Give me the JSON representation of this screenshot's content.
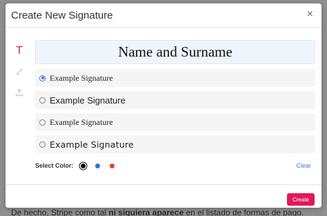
{
  "backdrop": {
    "text_before": "De hecho, Stripe como tal",
    "text_bold": "ni siquiera aparece",
    "text_after": "en el listado de formas de pago."
  },
  "modal": {
    "title": "Create New Signature",
    "close_symbol": "×"
  },
  "tools": [
    {
      "name": "text-tool",
      "glyph": "T",
      "active": true
    },
    {
      "name": "draw-tool",
      "icon": "brush-icon",
      "active": false
    },
    {
      "name": "upload-tool",
      "icon": "upload-icon",
      "active": false
    }
  ],
  "preview": {
    "text": "Name and Surname"
  },
  "options": [
    {
      "label": "Example Signature",
      "selected": true
    },
    {
      "label": "Example Signature",
      "selected": false
    },
    {
      "label": "Example Signature",
      "selected": false
    },
    {
      "label": "Example Signature",
      "selected": false
    }
  ],
  "colors": {
    "label": "Select Color:",
    "swatches": [
      "#000000",
      "#3b6fd6",
      "#e0413b"
    ],
    "selected": "#000000",
    "clear_label": "Clear"
  },
  "footer": {
    "create_label": "Create",
    "accent": "#e0195c"
  }
}
